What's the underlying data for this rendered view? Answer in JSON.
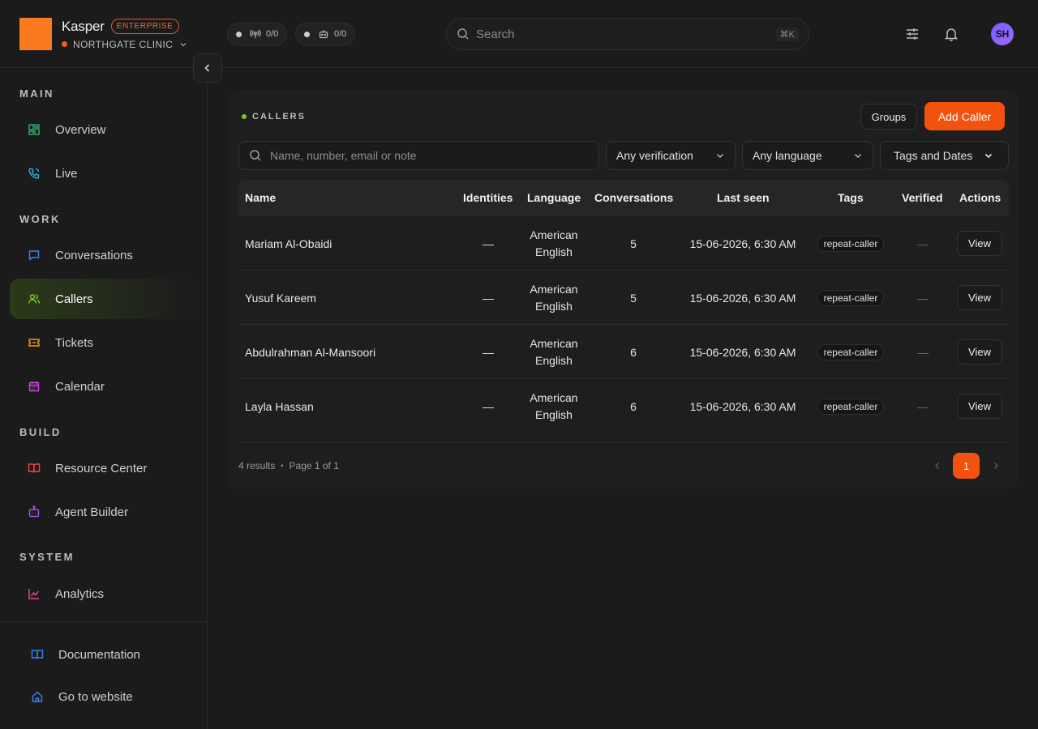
{
  "brand": {
    "name": "Kasper",
    "plan_badge": "ENTERPRISE",
    "org": "NORTHGATE CLINIC"
  },
  "status_pills": [
    {
      "icon": "broadcast-icon",
      "value": "0/0"
    },
    {
      "icon": "robot-icon",
      "value": "0/0"
    }
  ],
  "search": {
    "placeholder": "Search",
    "shortcut": "⌘K"
  },
  "user": {
    "initials": "SH"
  },
  "sidebar": {
    "sections": {
      "main": "MAIN",
      "work": "WORK",
      "build": "BUILD",
      "system": "SYSTEM"
    },
    "items": [
      {
        "label": "Overview",
        "icon": "grid-icon",
        "color": "#2bb673"
      },
      {
        "label": "Live",
        "icon": "phone-icon",
        "color": "#2bb1d8"
      },
      {
        "label": "Conversations",
        "icon": "chat-icon",
        "color": "#3b82f6"
      },
      {
        "label": "Callers",
        "icon": "users-icon",
        "color": "#7cc72c",
        "active": true
      },
      {
        "label": "Tickets",
        "icon": "ticket-icon",
        "color": "#f59e0b"
      },
      {
        "label": "Calendar",
        "icon": "calendar-icon",
        "color": "#d946ef"
      },
      {
        "label": "Resource Center",
        "icon": "book-icon",
        "color": "#ef4444"
      },
      {
        "label": "Agent Builder",
        "icon": "bot-icon",
        "color": "#a855f7"
      },
      {
        "label": "Analytics",
        "icon": "chart-icon",
        "color": "#ec4899"
      }
    ],
    "footer": [
      {
        "label": "Documentation",
        "icon": "docs-icon",
        "color": "#3b82f6"
      },
      {
        "label": "Go to website",
        "icon": "home-icon",
        "color": "#3b82f6"
      }
    ]
  },
  "callers": {
    "title": "CALLERS",
    "groups_label": "Groups",
    "add_label": "Add Caller",
    "search_placeholder": "Name, number, email or note",
    "filters": {
      "verification": "Any verification",
      "language": "Any language",
      "tags_dates": "Tags and Dates"
    },
    "columns": [
      "Name",
      "Identities",
      "Language",
      "Conversations",
      "Last seen",
      "Tags",
      "Verified",
      "Actions"
    ],
    "rows": [
      {
        "name": "Mariam Al-Obaidi",
        "identities": "—",
        "language_1": "American",
        "language_2": "English",
        "conversations": "5",
        "last_seen": "15-06-2026, 6:30 AM",
        "tag": "repeat-caller",
        "verified": "—",
        "action": "View"
      },
      {
        "name": "Yusuf Kareem",
        "identities": "—",
        "language_1": "American",
        "language_2": "English",
        "conversations": "5",
        "last_seen": "15-06-2026, 6:30 AM",
        "tag": "repeat-caller",
        "verified": "—",
        "action": "View"
      },
      {
        "name": "Abdulrahman Al-Mansoori",
        "identities": "—",
        "language_1": "American",
        "language_2": "English",
        "conversations": "6",
        "last_seen": "15-06-2026, 6:30 AM",
        "tag": "repeat-caller",
        "verified": "—",
        "action": "View"
      },
      {
        "name": "Layla Hassan",
        "identities": "—",
        "language_1": "American",
        "language_2": "English",
        "conversations": "6",
        "last_seen": "15-06-2026, 6:30 AM",
        "tag": "repeat-caller",
        "verified": "—",
        "action": "View"
      }
    ],
    "results_text": "4 results",
    "page_text": "Page 1 of 1",
    "current_page": "1"
  }
}
